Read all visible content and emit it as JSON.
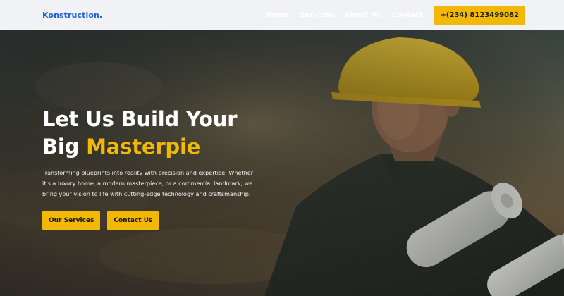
{
  "nav": {
    "brand": "Konstruction.",
    "links": [
      "Home",
      "Services",
      "About Us",
      "Contact"
    ],
    "phone": "+(234) 8123499082"
  },
  "hero": {
    "title_line1": "Let Us Build Your",
    "title_line2_prefix": "Big ",
    "title_line2_accent": "Masterpie",
    "description": "Transforming blueprints into reality with precision and expertise. Whether it's a luxury home, a modern masterpiece, or a commercial landmark, we bring your vision to life with cutting-edge technology and craftsmanship.",
    "buttons": [
      "Our Services",
      "Contact Us"
    ]
  },
  "colors": {
    "accent": "#f2b807",
    "brand": "#1f63d6",
    "navbar": "#f1f2f5"
  },
  "icons": {
    "hero_image": "construction-worker-photo"
  }
}
